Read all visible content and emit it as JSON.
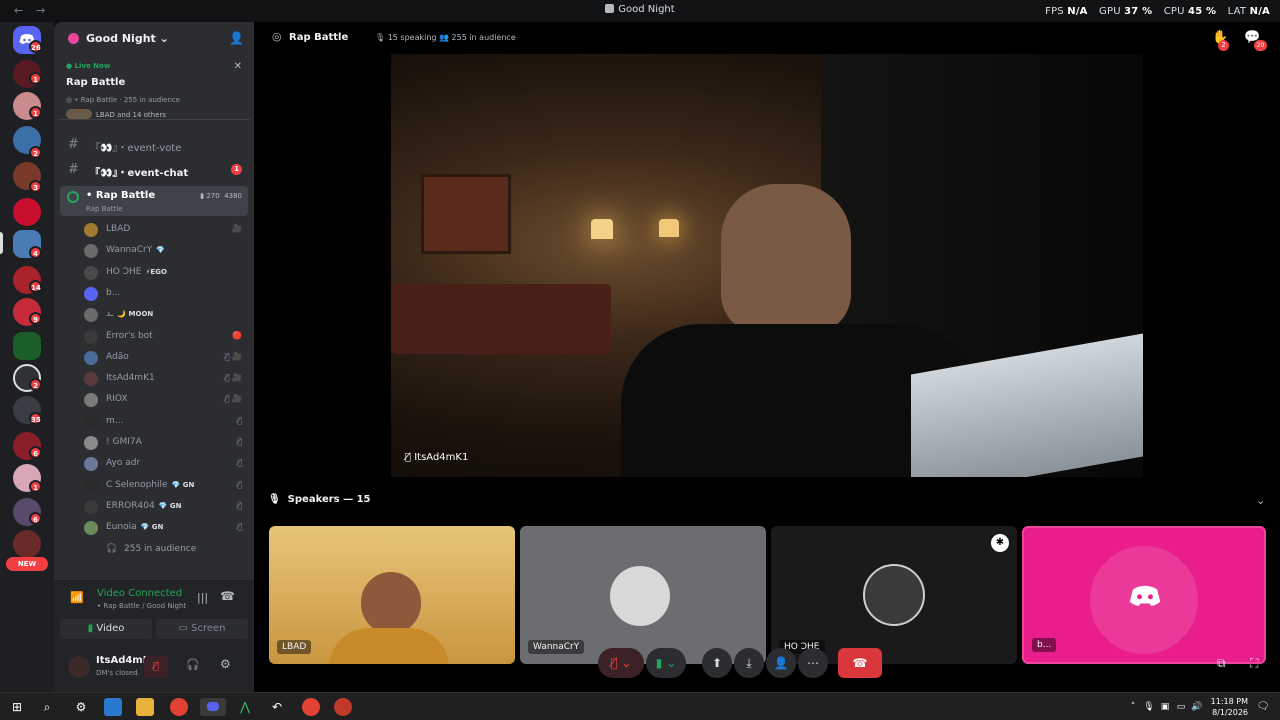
{
  "titlebar": {
    "title": "Good Night",
    "fps_label": "FPS",
    "fps_value": "N/A",
    "gpu_label": "GPU",
    "gpu_value": "37 %",
    "cpu_label": "CPU",
    "cpu_value": "45 %",
    "lat_label": "LAT",
    "lat_value": "N/A"
  },
  "rail": {
    "dm_badge": "26",
    "guild_badges": [
      "1",
      "1",
      "2",
      "3",
      "4",
      "14",
      "9",
      "2",
      "35",
      "6",
      "1",
      "6"
    ],
    "new_label": "NEW"
  },
  "server": {
    "name": "Good Night",
    "live": {
      "live_label": "Live Now",
      "title": "Rap Battle",
      "meta": "• Rap Battle · 255 in audience",
      "participants": "LBAD and 14 others"
    },
    "channels": [
      {
        "name": "『👀』・event-vote",
        "badge": ""
      },
      {
        "name": "『👀』・event-chat",
        "badge": "1"
      }
    ],
    "voice_channel": {
      "name": "• Rap Battle",
      "sub": "Rap Battle",
      "video_count": "270",
      "user_count": "4380"
    },
    "members": [
      {
        "name": "LBAD",
        "tag": "",
        "icons": "🎥"
      },
      {
        "name": "WannaCrY",
        "tag": "💎",
        "icons": ""
      },
      {
        "name": "HO ƆHE",
        "tag": "⚡EGO",
        "icons": ""
      },
      {
        "name": "b...",
        "tag": "",
        "icons": ""
      },
      {
        "name": "ـد",
        "tag": "🌙 MOON",
        "icons": ""
      },
      {
        "name": "Error's bot",
        "tag": "",
        "icons": "🔴"
      },
      {
        "name": "Adão",
        "tag": "",
        "icons": "🎙̸ 🎥"
      },
      {
        "name": "ItsAd4mK1",
        "tag": "",
        "icons": "🎙̸ 🎥"
      },
      {
        "name": "RIOX",
        "tag": "",
        "icons": "🎙̸ 🎥"
      },
      {
        "name": "m...",
        "tag": "",
        "icons": "🎙̸"
      },
      {
        "name": "! GMI7A",
        "tag": "",
        "icons": "🎙̸"
      },
      {
        "name": "Ayo adr",
        "tag": "",
        "icons": "🎙̸"
      },
      {
        "name": "C Selenophile",
        "tag": "💎 GN",
        "icons": "🎙̸"
      },
      {
        "name": "ERROR404",
        "tag": "💎 GN",
        "icons": "🎙̸"
      },
      {
        "name": "Eunoia",
        "tag": "💎 GN",
        "icons": "🎙̸"
      }
    ],
    "audience_label": "255 in audience"
  },
  "rtc": {
    "status": "Video Connected",
    "sub": "• Rap Battle / Good Night",
    "video_label": "Video",
    "screen_label": "Screen"
  },
  "user": {
    "name": "ItsAd4mK1",
    "status": "DM's closed."
  },
  "main": {
    "channel": "Rap Battle",
    "speaking": "15 speaking",
    "audience": "255 in audience",
    "stage_name": "ItsAd4mK1",
    "speakers_label": "Speakers — 15",
    "hand_badge": "2",
    "chat_badge": "20",
    "tiles": [
      {
        "name": "LBAD"
      },
      {
        "name": "WannaCrY"
      },
      {
        "name": "HO ƆHE"
      },
      {
        "name": "b..."
      }
    ]
  },
  "taskbar": {
    "time": "11:18 PM",
    "date": "8/1/2026"
  },
  "colors": {
    "accent": "#5865f2",
    "online": "#23a55a",
    "danger": "#da373c",
    "badge": "#f23f43",
    "pink_tile": "#e91e8c"
  }
}
